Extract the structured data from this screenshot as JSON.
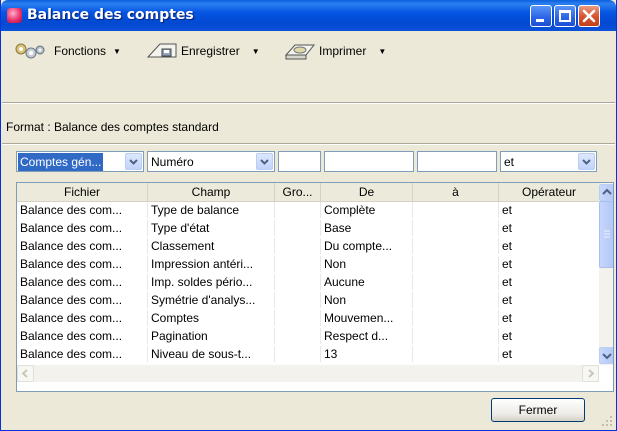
{
  "window": {
    "title": "Balance des comptes"
  },
  "toolbar": {
    "functions_label": "Fonctions",
    "save_label": "Enregistrer",
    "print_label": "Imprimer"
  },
  "format_label": "Format : Balance des comptes standard",
  "filters": {
    "account_select": "Comptes gén...",
    "field_select": "Numéro",
    "group_value": "",
    "from_value": "",
    "to_value": "",
    "operator_select": "et"
  },
  "table": {
    "columns": [
      "Fichier",
      "Champ",
      "Gro...",
      "De",
      "à",
      "Opérateur"
    ],
    "rows": [
      [
        "Balance des com...",
        "Type de balance",
        "",
        "Complète",
        "",
        "et"
      ],
      [
        "Balance des com...",
        "Type d'état",
        "",
        "Base",
        "",
        "et"
      ],
      [
        "Balance des com...",
        "Classement",
        "",
        "Du compte...",
        "",
        "et"
      ],
      [
        "Balance des com...",
        "Impression antéri...",
        "",
        "Non",
        "",
        "et"
      ],
      [
        "Balance des com...",
        "Imp. soldes pério...",
        "",
        "Aucune",
        "",
        "et"
      ],
      [
        "Balance des com...",
        "Symétrie d'analys...",
        "",
        "Non",
        "",
        "et"
      ],
      [
        "Balance des com...",
        "Comptes",
        "",
        "Mouvemen...",
        "",
        "et"
      ],
      [
        "Balance des com...",
        "Pagination",
        "",
        "Respect d...",
        "",
        "et"
      ],
      [
        "Balance des com...",
        "Niveau de sous-t...",
        "",
        "13",
        "",
        "et"
      ]
    ]
  },
  "close_button_label": "Fermer",
  "colors": {
    "titlebar": "#0555e2",
    "selection": "#316ac5",
    "window_bg": "#ece9d8"
  }
}
